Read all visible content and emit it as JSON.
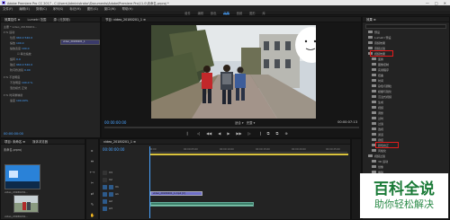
{
  "window": {
    "title": "Adobe Premiere Pro CC 2017 - C:\\Users\\Administrator\\Documents\\Adobe\\Premiere Pro\\11.0\\未命名.prproj *",
    "controls": [
      "—",
      "□",
      "✕"
    ]
  },
  "menu": [
    "文件(F)",
    "编辑(E)",
    "剪辑(C)",
    "序列(S)",
    "标记(M)",
    "图形(G)",
    "窗口(W)",
    "帮助(H)"
  ],
  "workspace_tabs": [
    "组件",
    "编辑",
    "颜色",
    "效果",
    "音频",
    "图形",
    "库"
  ],
  "workspace_active": "效果",
  "effect_controls": {
    "tabs": [
      "效果控件 ≡",
      "Lumetri 范围",
      "源: (无剪辑)"
    ],
    "mini_clip": "video_20180201_1",
    "timecode": "00:00:00:00",
    "rows": [
      "主要 * video_20180201...",
      "▾ fx 运动",
      "位置",
      "缩放",
      "缩放宽度",
      "☑ 等比缩放",
      "旋转",
      "锚点",
      "防闪烁滤镜",
      "▾ fx 不透明度",
      "不透明度",
      "混合模式",
      "▾ fx 时间重映射",
      "速度"
    ],
    "values": [
      "",
      "",
      "960.0  540.0",
      "100.0",
      "100.0",
      "",
      "0.0",
      "960.0  540.0",
      "0.00",
      "",
      "100.0 %",
      "正常",
      "",
      "100.00%"
    ]
  },
  "program_monitor": {
    "tab": "节目: video_20180201_1 ≡",
    "timecode": "00:00:00:00",
    "fit": "适合",
    "quality": "完整",
    "duration": "00:00:07:13",
    "controls": [
      "⎸",
      "◁",
      "◀◀",
      "◀",
      "▶",
      "▶▶",
      "▷",
      "⎹",
      "⧉",
      "⧉",
      "⊕"
    ]
  },
  "effects": {
    "tab": "效果 ≡",
    "search_placeholder": "",
    "items": [
      "预设",
      "Lumetri 预设",
      "音频效果",
      "音频过渡",
      "视频效果",
      "变换",
      "图像控制",
      "实用程序",
      "扭曲",
      "时间",
      "杂色与颗粒",
      "模糊与锐化",
      "沉浸式视频",
      "生成",
      "视频",
      "调整",
      "过时",
      "过渡",
      "透视",
      "通道",
      "键控",
      "颜色校正",
      "风格化",
      "视频过渡",
      "3D 运动",
      "划像",
      "擦除",
      "沉浸式视频",
      "溶解",
      "滑动",
      "缩放",
      "页面剥落"
    ]
  },
  "project": {
    "tabs": [
      "项目: 未命名 ≡",
      "媒体浏览器"
    ],
    "name": "未命名.prproj",
    "items": [
      "video_20180201...",
      "video_20180201..."
    ]
  },
  "tools": [
    "▸",
    "⇹",
    "⟷",
    "✂",
    "⇄",
    "✎",
    "✋",
    "T"
  ],
  "timeline": {
    "tab": "video_20180201_1 ≡",
    "timecode": "00:00:00:00",
    "ticks": [
      "00:00",
      "00:00:05:00",
      "00:00:10:00",
      "00:00:15:00",
      "00:00:20:00",
      "00:00:25:00"
    ],
    "tracks": [
      "V3",
      "V2",
      "V1",
      "A1",
      "A2",
      "A3"
    ],
    "clip_name": "video_20180201_1.mp4 [V]"
  },
  "watermark": {
    "big": "百科全说",
    "small": "助你轻松解决"
  },
  "colors": {
    "accent": "#4aa3ff",
    "highlight_box": "#e21c1c",
    "watermark_green": "#1a7a37"
  }
}
